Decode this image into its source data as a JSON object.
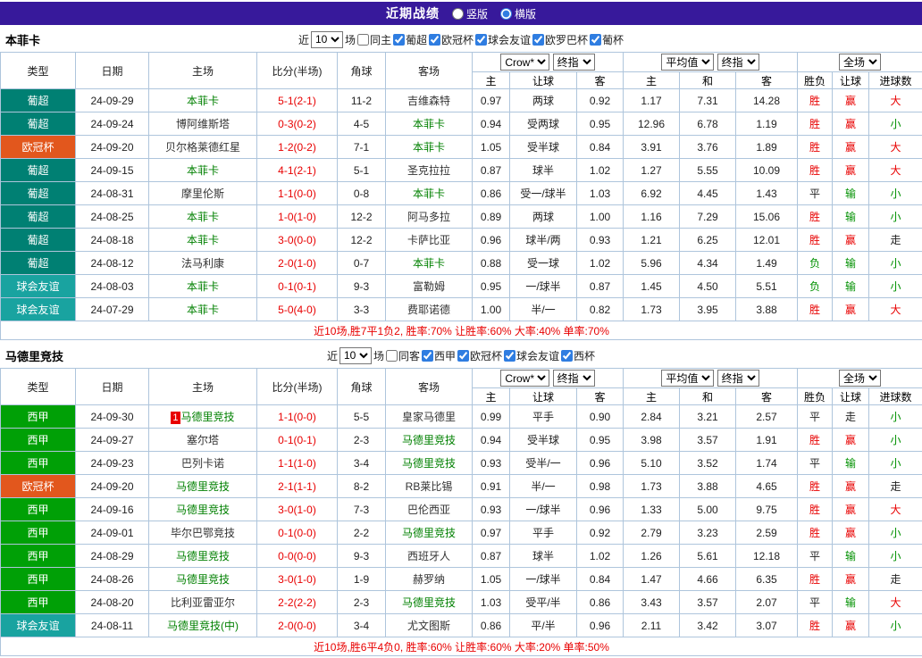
{
  "topbar": {
    "title": "近期战绩",
    "options": [
      {
        "label": "竖版",
        "selected": false
      },
      {
        "label": "横版",
        "selected": true
      }
    ]
  },
  "league_colors": {
    "葡超": "#008073",
    "欧冠杯": "#e2571d",
    "球会友谊": "#19a3a0",
    "西甲": "#00a006"
  },
  "result_colors": {
    "胜": "red",
    "赢": "red",
    "大": "red",
    "负": "green",
    "输": "green",
    "小": "green",
    "平": "dark",
    "走": "dark"
  },
  "sections": [
    {
      "team": "本菲卡",
      "filters": {
        "near": "近",
        "count": "10",
        "games": "场",
        "same_venue": "同主",
        "leagues": [
          "葡超",
          "欧冠杯",
          "球会友谊",
          "欧罗巴杯",
          "葡杯"
        ]
      },
      "header": {
        "static_cols": [
          "类型",
          "日期",
          "主场",
          "比分(半场)",
          "角球",
          "客场"
        ],
        "group1": {
          "dd1": "Crow*",
          "dd2": "终指",
          "cols": [
            "主",
            "让球",
            "客"
          ]
        },
        "group2": {
          "dd1": "平均值",
          "dd2": "终指",
          "cols": [
            "主",
            "和",
            "客"
          ]
        },
        "group3": {
          "dd": "全场",
          "cols": [
            "胜负",
            "让球",
            "进球数"
          ]
        }
      },
      "rows": [
        {
          "league": "葡超",
          "date": "24-09-29",
          "home": "本菲卡",
          "home_hl": true,
          "score": "5-1(2-1)",
          "corner": "11-2",
          "away": "吉维森特",
          "away_hl": false,
          "o1": "0.97",
          "line": "两球",
          "o2": "0.92",
          "m1": "1.17",
          "m2": "7.31",
          "m3": "14.28",
          "r1": "胜",
          "r2": "赢",
          "r3": "大"
        },
        {
          "league": "葡超",
          "date": "24-09-24",
          "home": "博阿维斯塔",
          "home_hl": false,
          "score": "0-3(0-2)",
          "corner": "4-5",
          "away": "本菲卡",
          "away_hl": true,
          "o1": "0.94",
          "line": "受两球",
          "o2": "0.95",
          "m1": "12.96",
          "m2": "6.78",
          "m3": "1.19",
          "r1": "胜",
          "r2": "赢",
          "r3": "小"
        },
        {
          "league": "欧冠杯",
          "date": "24-09-20",
          "home": "贝尔格莱德红星",
          "home_hl": false,
          "score": "1-2(0-2)",
          "corner": "7-1",
          "away": "本菲卡",
          "away_hl": true,
          "o1": "1.05",
          "line": "受半球",
          "o2": "0.84",
          "m1": "3.91",
          "m2": "3.76",
          "m3": "1.89",
          "r1": "胜",
          "r2": "赢",
          "r3": "大"
        },
        {
          "league": "葡超",
          "date": "24-09-15",
          "home": "本菲卡",
          "home_hl": true,
          "score": "4-1(2-1)",
          "corner": "5-1",
          "away": "圣克拉拉",
          "away_hl": false,
          "o1": "0.87",
          "line": "球半",
          "o2": "1.02",
          "m1": "1.27",
          "m2": "5.55",
          "m3": "10.09",
          "r1": "胜",
          "r2": "赢",
          "r3": "大"
        },
        {
          "league": "葡超",
          "date": "24-08-31",
          "home": "摩里伦斯",
          "home_hl": false,
          "score": "1-1(0-0)",
          "corner": "0-8",
          "away": "本菲卡",
          "away_hl": true,
          "o1": "0.86",
          "line": "受一/球半",
          "o2": "1.03",
          "m1": "6.92",
          "m2": "4.45",
          "m3": "1.43",
          "r1": "平",
          "r2": "输",
          "r3": "小"
        },
        {
          "league": "葡超",
          "date": "24-08-25",
          "home": "本菲卡",
          "home_hl": true,
          "score": "1-0(1-0)",
          "corner": "12-2",
          "away": "阿马多拉",
          "away_hl": false,
          "o1": "0.89",
          "line": "两球",
          "o2": "1.00",
          "m1": "1.16",
          "m2": "7.29",
          "m3": "15.06",
          "r1": "胜",
          "r2": "输",
          "r3": "小"
        },
        {
          "league": "葡超",
          "date": "24-08-18",
          "home": "本菲卡",
          "home_hl": true,
          "score": "3-0(0-0)",
          "corner": "12-2",
          "away": "卡萨比亚",
          "away_hl": false,
          "o1": "0.96",
          "line": "球半/两",
          "o2": "0.93",
          "m1": "1.21",
          "m2": "6.25",
          "m3": "12.01",
          "r1": "胜",
          "r2": "赢",
          "r3": "走"
        },
        {
          "league": "葡超",
          "date": "24-08-12",
          "home": "法马利康",
          "home_hl": false,
          "score": "2-0(1-0)",
          "corner": "0-7",
          "away": "本菲卡",
          "away_hl": true,
          "o1": "0.88",
          "line": "受一球",
          "o2": "1.02",
          "m1": "5.96",
          "m2": "4.34",
          "m3": "1.49",
          "r1": "负",
          "r2": "输",
          "r3": "小"
        },
        {
          "league": "球会友谊",
          "date": "24-08-03",
          "home": "本菲卡",
          "home_hl": true,
          "score": "0-1(0-1)",
          "corner": "9-3",
          "away": "富勒姆",
          "away_hl": false,
          "o1": "0.95",
          "line": "一/球半",
          "o2": "0.87",
          "m1": "1.45",
          "m2": "4.50",
          "m3": "5.51",
          "r1": "负",
          "r2": "输",
          "r3": "小"
        },
        {
          "league": "球会友谊",
          "date": "24-07-29",
          "home": "本菲卡",
          "home_hl": true,
          "score": "5-0(4-0)",
          "corner": "3-3",
          "away": "费耶诺德",
          "away_hl": false,
          "o1": "1.00",
          "line": "半/一",
          "o2": "0.82",
          "m1": "1.73",
          "m2": "3.95",
          "m3": "3.88",
          "r1": "胜",
          "r2": "赢",
          "r3": "大"
        }
      ],
      "summary": "近10场,胜7平1负2, 胜率:70% 让胜率:60% 大率:40% 单率:70%"
    },
    {
      "team": "马德里竞技",
      "filters": {
        "near": "近",
        "count": "10",
        "games": "场",
        "same_venue": "同客",
        "leagues": [
          "西甲",
          "欧冠杯",
          "球会友谊",
          "西杯"
        ]
      },
      "header": {
        "static_cols": [
          "类型",
          "日期",
          "主场",
          "比分(半场)",
          "角球",
          "客场"
        ],
        "group1": {
          "dd1": "Crow*",
          "dd2": "终指",
          "cols": [
            "主",
            "让球",
            "客"
          ]
        },
        "group2": {
          "dd1": "平均值",
          "dd2": "终指",
          "cols": [
            "主",
            "和",
            "客"
          ]
        },
        "group3": {
          "dd": "全场",
          "cols": [
            "胜负",
            "让球",
            "进球数"
          ]
        }
      },
      "rows": [
        {
          "league": "西甲",
          "date": "24-09-30",
          "home": "马德里竞技",
          "home_hl": true,
          "rank": "1",
          "score": "1-1(0-0)",
          "corner": "5-5",
          "away": "皇家马德里",
          "away_hl": false,
          "o1": "0.99",
          "line": "平手",
          "o2": "0.90",
          "m1": "2.84",
          "m2": "3.21",
          "m3": "2.57",
          "r1": "平",
          "r2": "走",
          "r3": "小"
        },
        {
          "league": "西甲",
          "date": "24-09-27",
          "home": "塞尔塔",
          "home_hl": false,
          "score": "0-1(0-1)",
          "corner": "2-3",
          "away": "马德里竞技",
          "away_hl": true,
          "o1": "0.94",
          "line": "受半球",
          "o2": "0.95",
          "m1": "3.98",
          "m2": "3.57",
          "m3": "1.91",
          "r1": "胜",
          "r2": "赢",
          "r3": "小"
        },
        {
          "league": "西甲",
          "date": "24-09-23",
          "home": "巴列卡诺",
          "home_hl": false,
          "score": "1-1(1-0)",
          "corner": "3-4",
          "away": "马德里竞技",
          "away_hl": true,
          "o1": "0.93",
          "line": "受半/一",
          "o2": "0.96",
          "m1": "5.10",
          "m2": "3.52",
          "m3": "1.74",
          "r1": "平",
          "r2": "输",
          "r3": "小"
        },
        {
          "league": "欧冠杯",
          "date": "24-09-20",
          "home": "马德里竞技",
          "home_hl": true,
          "score": "2-1(1-1)",
          "corner": "8-2",
          "away": "RB莱比锡",
          "away_hl": false,
          "o1": "0.91",
          "line": "半/一",
          "o2": "0.98",
          "m1": "1.73",
          "m2": "3.88",
          "m3": "4.65",
          "r1": "胜",
          "r2": "赢",
          "r3": "走"
        },
        {
          "league": "西甲",
          "date": "24-09-16",
          "home": "马德里竞技",
          "home_hl": true,
          "score": "3-0(1-0)",
          "corner": "7-3",
          "away": "巴伦西亚",
          "away_hl": false,
          "o1": "0.93",
          "line": "一/球半",
          "o2": "0.96",
          "m1": "1.33",
          "m2": "5.00",
          "m3": "9.75",
          "r1": "胜",
          "r2": "赢",
          "r3": "大"
        },
        {
          "league": "西甲",
          "date": "24-09-01",
          "home": "毕尔巴鄂竞技",
          "home_hl": false,
          "score": "0-1(0-0)",
          "corner": "2-2",
          "away": "马德里竞技",
          "away_hl": true,
          "o1": "0.97",
          "line": "平手",
          "o2": "0.92",
          "m1": "2.79",
          "m2": "3.23",
          "m3": "2.59",
          "r1": "胜",
          "r2": "赢",
          "r3": "小"
        },
        {
          "league": "西甲",
          "date": "24-08-29",
          "home": "马德里竞技",
          "home_hl": true,
          "score": "0-0(0-0)",
          "corner": "9-3",
          "away": "西班牙人",
          "away_hl": false,
          "o1": "0.87",
          "line": "球半",
          "o2": "1.02",
          "m1": "1.26",
          "m2": "5.61",
          "m3": "12.18",
          "r1": "平",
          "r2": "输",
          "r3": "小"
        },
        {
          "league": "西甲",
          "date": "24-08-26",
          "home": "马德里竞技",
          "home_hl": true,
          "score": "3-0(1-0)",
          "corner": "1-9",
          "away": "赫罗纳",
          "away_hl": false,
          "o1": "1.05",
          "line": "一/球半",
          "o2": "0.84",
          "m1": "1.47",
          "m2": "4.66",
          "m3": "6.35",
          "r1": "胜",
          "r2": "赢",
          "r3": "走"
        },
        {
          "league": "西甲",
          "date": "24-08-20",
          "home": "比利亚雷亚尔",
          "home_hl": false,
          "score": "2-2(2-2)",
          "corner": "2-3",
          "away": "马德里竞技",
          "away_hl": true,
          "o1": "1.03",
          "line": "受平/半",
          "o2": "0.86",
          "m1": "3.43",
          "m2": "3.57",
          "m3": "2.07",
          "r1": "平",
          "r2": "输",
          "r3": "大"
        },
        {
          "league": "球会友谊",
          "date": "24-08-11",
          "home": "马德里竞技(中)",
          "home_hl": true,
          "score": "2-0(0-0)",
          "corner": "3-4",
          "away": "尤文图斯",
          "away_hl": false,
          "o1": "0.86",
          "line": "平/半",
          "o2": "0.96",
          "m1": "2.11",
          "m2": "3.42",
          "m3": "3.07",
          "r1": "胜",
          "r2": "赢",
          "r3": "小"
        }
      ],
      "summary": "近10场,胜6平4负0, 胜率:60% 让胜率:60% 大率:20% 单率:50%"
    }
  ]
}
